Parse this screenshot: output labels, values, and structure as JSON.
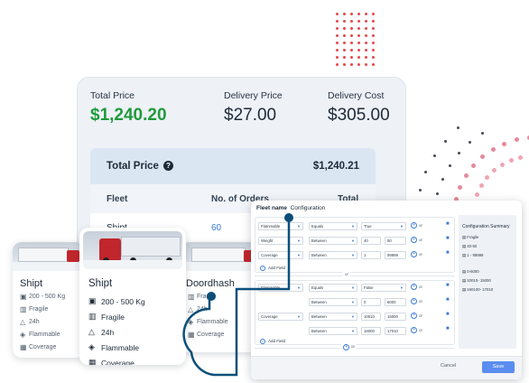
{
  "colors": {
    "accent_green": "#1f9a3b",
    "connector": "#0b4f7a",
    "link_blue": "#3a7bd5",
    "dots_red": "#e5484d",
    "dots_pink": "#f0a6b5"
  },
  "price_card": {
    "columns": [
      {
        "label": "Total Price",
        "value": "$1,240.20"
      },
      {
        "label": "Delivery Price",
        "value": "$27.00"
      },
      {
        "label": "Delivery Cost",
        "value": "$305.00"
      }
    ],
    "summary": {
      "title": "Total Price",
      "amount": "$1,240.21",
      "headers": {
        "fleet": "Fleet",
        "orders": "No. of Orders",
        "total": "Total"
      },
      "row": {
        "fleet": "Shipt",
        "orders": "60"
      }
    }
  },
  "cards": {
    "left": {
      "name": "Shipt",
      "features": [
        "200 - 500 Kg",
        "Fragile",
        "24h",
        "Flammable",
        "Coverage"
      ],
      "icons": [
        "box-icon",
        "fragile-icon",
        "clock-icon",
        "flame-icon",
        "map-icon"
      ]
    },
    "center": {
      "name": "Shipt",
      "features": [
        "200 - 500 Kg",
        "Fragile",
        "24h",
        "Flammable",
        "Coverage"
      ],
      "icons": [
        "box-icon",
        "fragile-icon",
        "clock-icon",
        "flame-icon",
        "map-icon"
      ]
    },
    "right": {
      "name": "Doordhash",
      "features": [
        "Fragile",
        "24h",
        "Flammable",
        "Coverage"
      ],
      "icons": [
        "fragile-icon",
        "clock-icon",
        "flame-icon",
        "map-icon"
      ]
    }
  },
  "config": {
    "title": "Fleet name",
    "subtitle": "Configuration",
    "group1": [
      {
        "field": "Flammable",
        "op": "Equals",
        "v1": "True",
        "v2": ""
      },
      {
        "field": "Weight",
        "op": "Between",
        "v1": "40",
        "v2": "50"
      },
      {
        "field": "Coverage",
        "op": "Between",
        "v1": "1",
        "v2": "99999"
      }
    ],
    "group2": [
      {
        "field": "Flammable",
        "op": "Equals",
        "v1": "False",
        "v2": ""
      },
      {
        "field": "",
        "op": "Between",
        "v1": "0",
        "v2": "6000"
      },
      {
        "field": "Coverage",
        "op": "Between",
        "v1": "10010",
        "v2": "15000"
      },
      {
        "field": "",
        "op": "Between",
        "v1": "16000",
        "v2": "17010"
      }
    ],
    "or_label": "or",
    "add_field": "Add Field",
    "summary": {
      "title": "Configuration Summary",
      "group1": [
        "Fragile",
        "40-50",
        "1 - 99999"
      ],
      "group2": [
        "0-6000",
        "10010- 15000",
        "160100- 17010"
      ]
    },
    "cancel": "Cancel",
    "save": "Save"
  }
}
